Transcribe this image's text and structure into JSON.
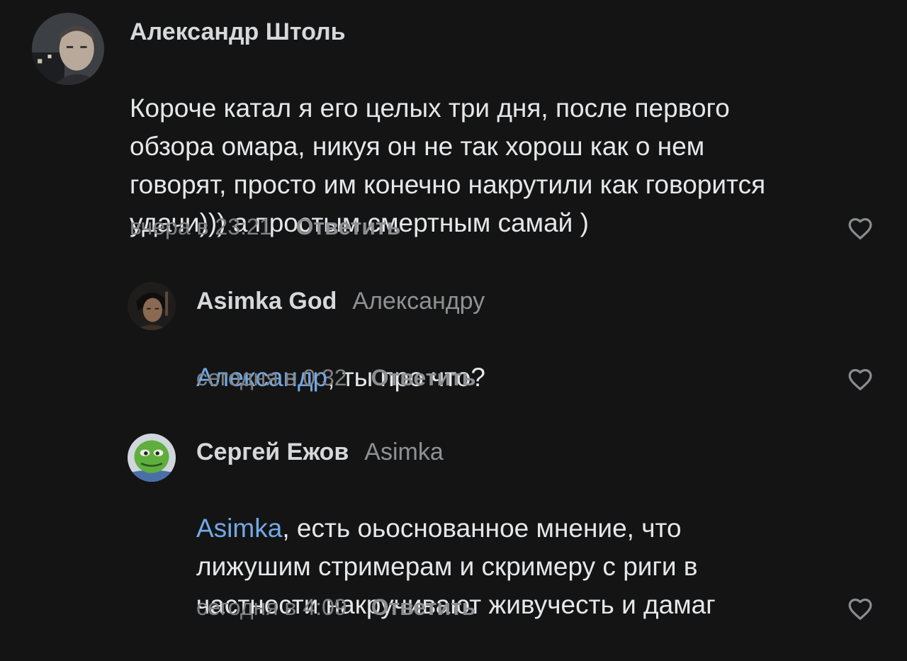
{
  "comments": [
    {
      "author": "Александр Штоль",
      "reply_to": "",
      "mention": "",
      "text": "Короче катал я его целых три дня, после первого\nобзора омара, никуя он не так хорош как о нем\nговорят, просто им конечно накрутили как говорится\nудачи))) а простым смертным самай )",
      "time": "вчера в 23:21",
      "reply_label": "Ответить",
      "like_icon": "heart-outline-icon"
    },
    {
      "author": "Asimka God",
      "reply_to": "Александру",
      "mention": "Александр",
      "text": ", ты про что?",
      "time": "сегодня в 0:32",
      "reply_label": "Ответить",
      "like_icon": "heart-outline-icon"
    },
    {
      "author": "Сергей Ежов",
      "reply_to": "Asimka",
      "mention": "Asimka",
      "text": ", есть оьоснованное мнение, что\nлижушим стримерам и скримеру с риги в\nчастности накручивают живучесть и дамаг",
      "time": "сегодня в 4:09",
      "reply_label": "Ответить",
      "like_icon": "heart-outline-icon"
    }
  ],
  "colors": {
    "background": "#141414",
    "mention": "#71a9e6",
    "secondary_text": "#7f8183"
  }
}
